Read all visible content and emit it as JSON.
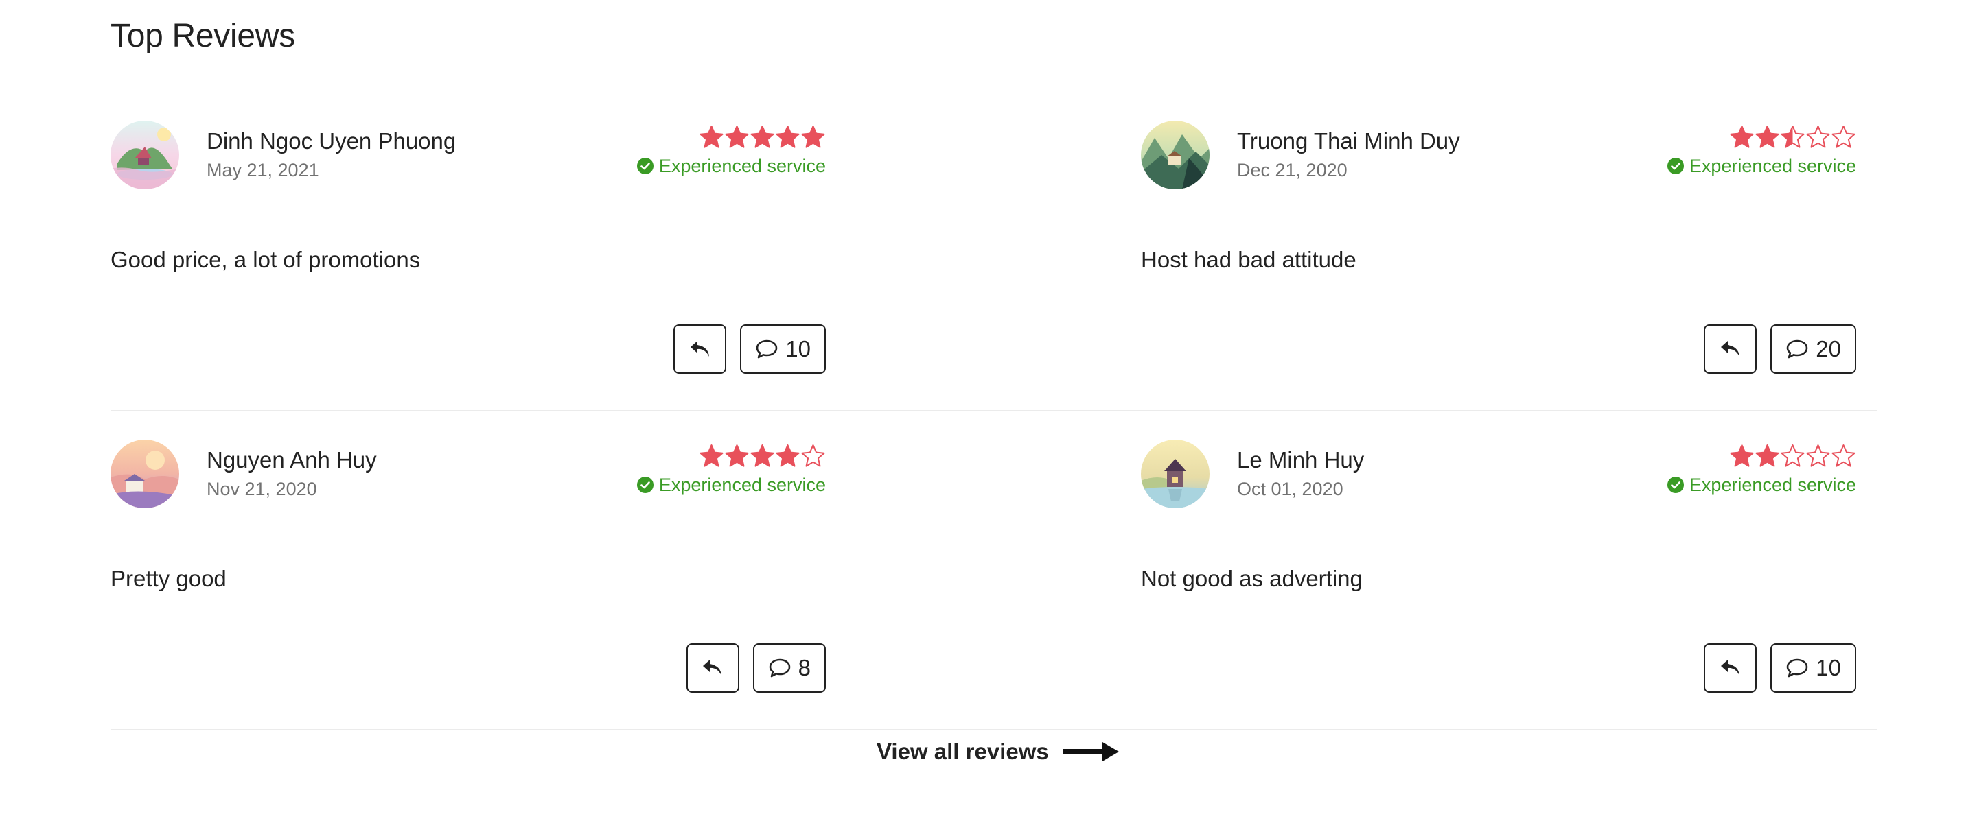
{
  "section_title": "Top Reviews",
  "rating_colors": {
    "filled": "#e8505b",
    "empty": "#e8505b"
  },
  "badge_color": "#3a9b25",
  "reviews": [
    {
      "name": "Dinh Ngoc Uyen Phuong",
      "date": "May 21, 2021",
      "rating": 5,
      "badge": "Experienced service",
      "text": "Good price, a lot of promotions",
      "comment_count": "10"
    },
    {
      "name": "Truong Thai Minh Duy",
      "date": "Dec 21, 2020",
      "rating": 2.5,
      "badge": "Experienced service",
      "text": "Host had bad attitude",
      "comment_count": "20"
    },
    {
      "name": "Nguyen Anh Huy",
      "date": "Nov 21, 2020",
      "rating": 4,
      "badge": "Experienced service",
      "text": "Pretty good",
      "comment_count": "8"
    },
    {
      "name": "Le Minh Huy",
      "date": "Oct 01, 2020",
      "rating": 2,
      "badge": "Experienced service",
      "text": "Not good as adverting",
      "comment_count": "10"
    }
  ],
  "view_all": {
    "label": "View all reviews",
    "icon": "arrow-right-icon"
  }
}
